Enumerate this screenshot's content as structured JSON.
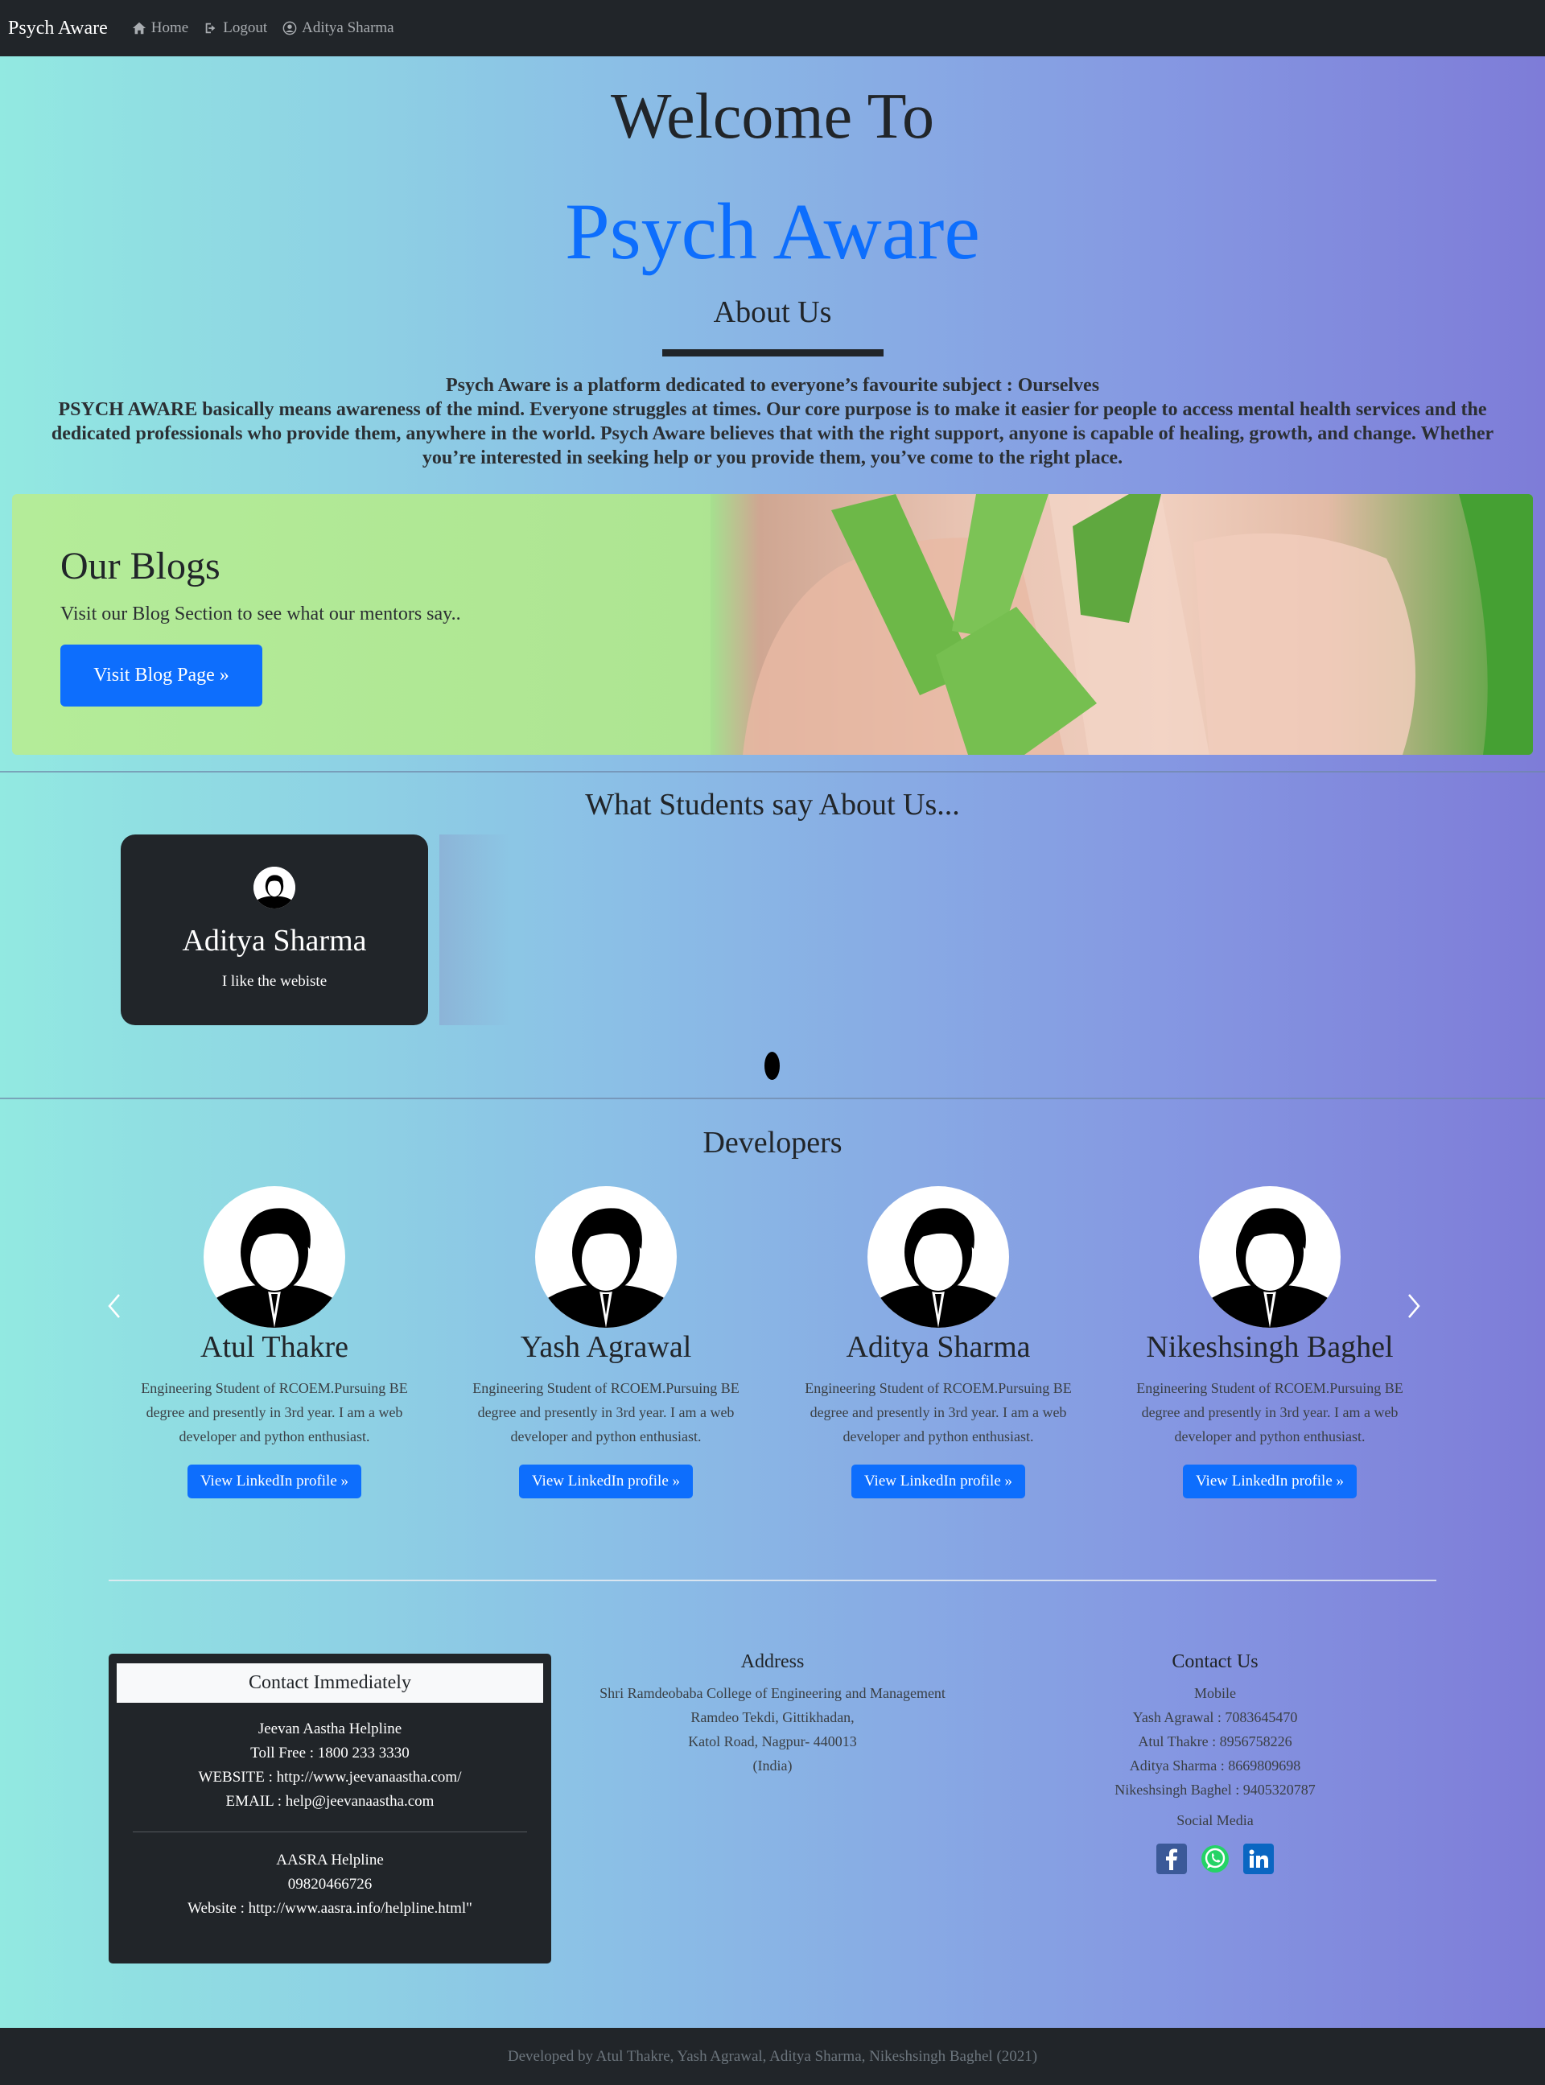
{
  "nav": {
    "brand": "Psych Aware",
    "home": "Home",
    "logout": "Logout",
    "user": "Aditya Sharma"
  },
  "hero": {
    "welcome": "Welcome To",
    "title": "Psych Aware",
    "about_heading": "About Us",
    "about_line1": "Psych Aware is a platform dedicated to everyone’s favourite subject : Ourselves",
    "about_line2": "PSYCH AWARE basically means awareness of the mind. Everyone struggles at times. Our core purpose is to make it easier for people to access mental health services and the dedicated professionals who provide them, anywhere in the world. Psych Aware believes that with the right support, anyone is capable of healing, growth, and change. Whether you’re interested in seeking help or you provide them, you’ve come to the right place."
  },
  "blog": {
    "title": "Our Blogs",
    "subtitle": "Visit our Blog Section to see what our mentors say..",
    "button": "Visit Blog Page »"
  },
  "testimonials": {
    "heading": "What Students say About Us...",
    "items": [
      {
        "name": "Aditya Sharma",
        "quote": "I like the webiste"
      }
    ]
  },
  "developers": {
    "heading": "Developers",
    "items": [
      {
        "name": "Atul Thakre",
        "desc": "Engineering Student of RCOEM.Pursuing BE degree and presently in 3rd year. I am a web developer and python enthusiast.",
        "button": "View LinkedIn profile »"
      },
      {
        "name": "Yash Agrawal",
        "desc": "Engineering Student of RCOEM.Pursuing BE degree and presently in 3rd year. I am a web developer and python enthusiast.",
        "button": "View LinkedIn profile »"
      },
      {
        "name": "Aditya Sharma",
        "desc": "Engineering Student of RCOEM.Pursuing BE degree and presently in 3rd year. I am a web developer and python enthusiast.",
        "button": "View LinkedIn profile »"
      },
      {
        "name": "Nikeshsingh Baghel",
        "desc": "Engineering Student of RCOEM.Pursuing BE degree and presently in 3rd year. I am a web developer and python enthusiast.",
        "button": "View LinkedIn profile »"
      }
    ]
  },
  "contact_box": {
    "heading": "Contact Immediately",
    "jeevan": {
      "name": "Jeevan Aastha Helpline",
      "tollfree": "Toll Free : 1800 233 3330",
      "website": "WEBSITE : http://www.jeevanaastha.com/",
      "email": "EMAIL : help@jeevanaastha.com"
    },
    "aasra": {
      "name": "AASRA Helpline",
      "phone": "09820466726",
      "website": "Website : http://www.aasra.info/helpline.html\""
    }
  },
  "address": {
    "heading": "Address",
    "line1": "Shri Ramdeobaba College of Engineering and Management",
    "line2": "Ramdeo Tekdi, Gittikhadan,",
    "line3": "Katol Road, Nagpur- 440013",
    "line4": "(India)"
  },
  "contact_us": {
    "heading": "Contact Us",
    "mobile_label": "Mobile",
    "numbers": [
      "Yash Agrawal : 7083645470",
      "Atul Thakre : 8956758226",
      "Aditya Sharma : 8669809698",
      "Nikeshsingh Baghel : 9405320787"
    ],
    "social_label": "Social Media",
    "social": [
      "facebook-icon",
      "whatsapp-icon",
      "linkedin-icon"
    ]
  },
  "footer": {
    "text": "Developed by Atul Thakre, Yash Agrawal, Aditya Sharma, Nikeshsingh Baghel (2021)"
  },
  "colors": {
    "accent": "#0d6efd",
    "dark": "#212529",
    "gradient_left": "#92e9e1",
    "gradient_right": "#7e7cd8"
  }
}
